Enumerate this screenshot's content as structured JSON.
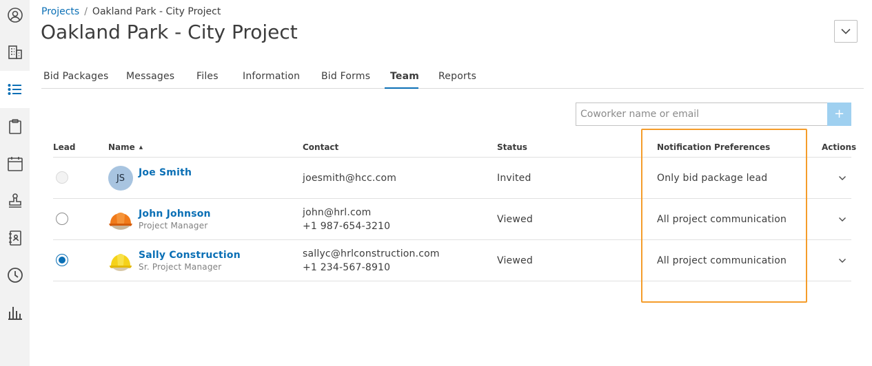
{
  "sidebar": {
    "items": [
      {
        "icon": "user-circle-icon"
      },
      {
        "icon": "building-icon"
      },
      {
        "icon": "list-icon",
        "active": true
      },
      {
        "icon": "clipboard-icon"
      },
      {
        "icon": "calendar-icon"
      },
      {
        "icon": "stamp-icon"
      },
      {
        "icon": "address-book-icon"
      },
      {
        "icon": "clock-icon"
      },
      {
        "icon": "bar-chart-icon"
      }
    ]
  },
  "breadcrumb": {
    "root": "Projects",
    "separator": "/",
    "current": "Oakland Park - City Project"
  },
  "page_title": "Oakland Park - City Project",
  "tabs": [
    {
      "label": "Bid Packages"
    },
    {
      "label": "Messages"
    },
    {
      "label": "Files"
    },
    {
      "label": "Information"
    },
    {
      "label": "Bid Forms"
    },
    {
      "label": "Team",
      "active": true
    },
    {
      "label": "Reports"
    }
  ],
  "search": {
    "placeholder": "Coworker name or email",
    "add_label": "+"
  },
  "table": {
    "headers": {
      "lead": "Lead",
      "name": "Name",
      "contact": "Contact",
      "status": "Status",
      "notifications": "Notification Preferences",
      "actions": "Actions"
    },
    "rows": [
      {
        "lead": "disabled",
        "avatar": "JS",
        "name": "Joe Smith",
        "role": "",
        "email": "joesmith@hcc.com",
        "phone": "",
        "status": "Invited",
        "notifications": "Only bid package lead"
      },
      {
        "lead": "unchecked",
        "avatar": "orange-hardhat",
        "name": "John Johnson",
        "role": "Project Manager",
        "email": "john@hrl.com",
        "phone": "+1 987-654-3210",
        "status": "Viewed",
        "notifications": "All project communication"
      },
      {
        "lead": "checked",
        "avatar": "yellow-hardhat",
        "name": "Sally Construction",
        "role": "Sr. Project Manager",
        "email": "sallyc@hrlconstruction.com",
        "phone": "+1 234-567-8910",
        "status": "Viewed",
        "notifications": "All project communication"
      }
    ]
  },
  "colors": {
    "accent": "#0a6fb5",
    "highlight": "#f59c2a",
    "sidebar_bg": "#f2f2f2"
  }
}
